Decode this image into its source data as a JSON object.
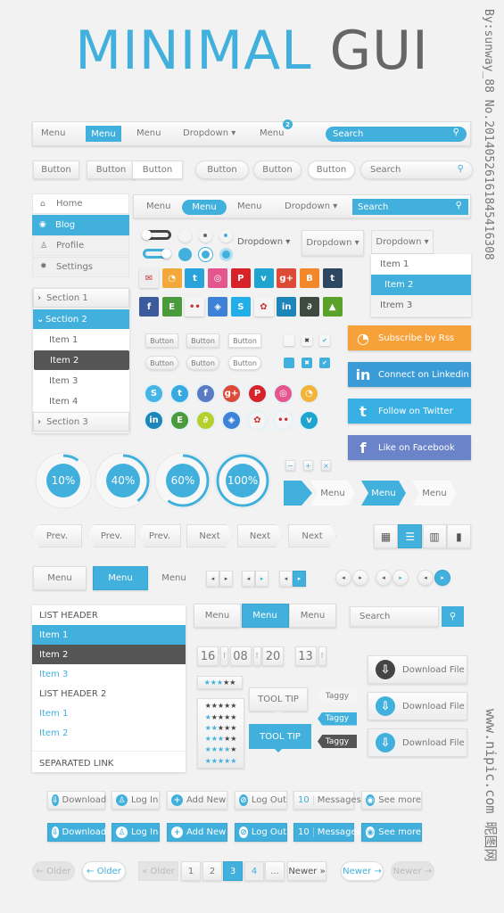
{
  "title": {
    "part1": "MINIMAL",
    "part2": "GUI"
  },
  "watermark": {
    "side": "By:sunway_88  No.20140526161845416308",
    "site": "www.nipic.com",
    "site_cn": "昵图网"
  },
  "colors": {
    "accent": "#41b0dc",
    "dark": "#555555",
    "rss": "#f7a13a",
    "linkedin": "#3a9bd6",
    "twitter": "#39b0e3",
    "facebook": "#6b83c8"
  },
  "navbar1": {
    "items": [
      "Menu",
      "Menu",
      "Menu",
      "Dropdown ▾",
      "Menu"
    ],
    "active": 1,
    "badge": "2",
    "search_placeholder": "Search"
  },
  "buttons_row": {
    "buttons": [
      "Button",
      "Button",
      "Button",
      "Button",
      "Button",
      "Button"
    ],
    "search_placeholder": "Search"
  },
  "sidebar": {
    "items": [
      {
        "label": "Home",
        "icon": "home-icon",
        "glyph": "⌂"
      },
      {
        "label": "Blog",
        "icon": "rss-icon",
        "glyph": "◉"
      },
      {
        "label": "Profile",
        "icon": "user-icon",
        "glyph": "♙"
      },
      {
        "label": "Settings",
        "icon": "gear-icon",
        "glyph": "✹"
      }
    ],
    "active": 1
  },
  "navbar2": {
    "items": [
      "Menu",
      "Menu",
      "Menu",
      "Dropdown ▾"
    ],
    "active": 1,
    "search_placeholder": "Search"
  },
  "toggles": [
    {
      "on": false
    },
    {
      "on": true
    }
  ],
  "radios": [
    "empty",
    "dot",
    "dot-blue",
    "filled",
    "filled-dark",
    "ring"
  ],
  "dropdowns": [
    "Dropdown ▾",
    "Dropdown ▾",
    "Dropdown ▾"
  ],
  "dropdown_menu": {
    "items": [
      "Item 1",
      "Item 2",
      "Itrem 3"
    ],
    "active": 1
  },
  "social_squares": [
    {
      "icon": "mail-icon",
      "glyph": "✉",
      "color": "#eeeeee"
    },
    {
      "icon": "rss-icon",
      "glyph": "◔",
      "color": "#f3a83a"
    },
    {
      "icon": "twitter-icon",
      "glyph": "t",
      "color": "#2aa3dc"
    },
    {
      "icon": "dribbble-icon",
      "glyph": "◎",
      "color": "#e5568e"
    },
    {
      "icon": "pinterest-icon",
      "glyph": "P",
      "color": "#d8222a"
    },
    {
      "icon": "vimeo-icon",
      "glyph": "v",
      "color": "#1fa4cf"
    },
    {
      "icon": "google-plus-icon",
      "glyph": "g+",
      "color": "#dc4b38"
    },
    {
      "icon": "blogger-icon",
      "glyph": "B",
      "color": "#f2882a"
    },
    {
      "icon": "tumblr-icon",
      "glyph": "t",
      "color": "#2d4761"
    },
    {
      "icon": "facebook-icon",
      "glyph": "f",
      "color": "#3c5b9a"
    },
    {
      "icon": "evernote-icon",
      "glyph": "E",
      "color": "#4a9b3c"
    },
    {
      "icon": "flickr-icon",
      "glyph": "••",
      "color": "#f4f4f4"
    },
    {
      "icon": "dropbox-icon",
      "glyph": "◈",
      "color": "#3d82d6"
    },
    {
      "icon": "skype-icon",
      "glyph": "S",
      "color": "#22aee6"
    },
    {
      "icon": "picasa-icon",
      "glyph": "✿",
      "color": "#f4f4f4"
    },
    {
      "icon": "linkedin-icon",
      "glyph": "in",
      "color": "#1d86b8"
    },
    {
      "icon": "deviantart-icon",
      "glyph": "∂",
      "color": "#3e4a40"
    },
    {
      "icon": "vine-icon",
      "glyph": "▲",
      "color": "#5ba22a"
    }
  ],
  "accordion": {
    "sections": [
      "Section 1",
      "Section 2",
      "Section 3"
    ],
    "items": [
      "Item 1",
      "Item 2",
      "Item 3",
      "Item 4"
    ],
    "open": 1,
    "active_item": 1
  },
  "small_buttons": [
    "Button",
    "Button",
    "Button",
    "Button",
    "Button",
    "Button"
  ],
  "checkboxes": [
    {
      "style": "light",
      "mark": ""
    },
    {
      "style": "light",
      "mark": "✖"
    },
    {
      "style": "light",
      "mark": "✔"
    },
    {
      "style": "blue",
      "mark": ""
    },
    {
      "style": "blue",
      "mark": "✖"
    },
    {
      "style": "blue",
      "mark": "✔"
    }
  ],
  "social_circles": [
    {
      "icon": "skype-icon",
      "glyph": "S",
      "color": "#45b4e6"
    },
    {
      "icon": "twitter-icon",
      "glyph": "t",
      "color": "#36a9e1"
    },
    {
      "icon": "facebook-icon",
      "glyph": "f",
      "color": "#5a7bc1"
    },
    {
      "icon": "google-plus-icon",
      "glyph": "g+",
      "color": "#dc4b38"
    },
    {
      "icon": "pinterest-icon",
      "glyph": "P",
      "color": "#d8222a"
    },
    {
      "icon": "dribbble-icon",
      "glyph": "◎",
      "color": "#e5568e"
    },
    {
      "icon": "rss-icon",
      "glyph": "◔",
      "color": "#f3b33a"
    },
    {
      "icon": "linkedin-icon",
      "glyph": "in",
      "color": "#1d86b8"
    },
    {
      "icon": "evernote-icon",
      "glyph": "E",
      "color": "#4a9b3c"
    },
    {
      "icon": "deviantart-icon",
      "glyph": "∂",
      "color": "#b6cf2a"
    },
    {
      "icon": "dropbox-icon",
      "glyph": "◈",
      "color": "#3d82d6"
    },
    {
      "icon": "picasa-icon",
      "glyph": "✿",
      "color": "#f4f4f4"
    },
    {
      "icon": "flickr-icon",
      "glyph": "••",
      "color": "#f4f4f4"
    },
    {
      "icon": "vimeo-icon",
      "glyph": "v",
      "color": "#1fa4cf"
    }
  ],
  "social_buttons": [
    {
      "label": "Subscribe by Rss",
      "icon": "rss-icon",
      "glyph": "◔",
      "color": "#f7a13a"
    },
    {
      "label": "Connect on Linkedin",
      "icon": "linkedin-icon",
      "glyph": "in",
      "color": "#3a9bd6"
    },
    {
      "label": "Follow on Twitter",
      "icon": "twitter-icon",
      "glyph": "t",
      "color": "#39b0e3"
    },
    {
      "label": "Like on Facebook",
      "icon": "facebook-icon",
      "glyph": "f",
      "color": "#6b83c8"
    }
  ],
  "progress": [
    {
      "value": 10,
      "label": "10%"
    },
    {
      "value": 40,
      "label": "40%"
    },
    {
      "value": 60,
      "label": "60%"
    },
    {
      "value": 100,
      "label": "100%"
    }
  ],
  "mini_buttons": [
    "−",
    "+",
    "×"
  ],
  "breadcrumb": {
    "items": [
      "Menu",
      "Menu",
      "Menu"
    ],
    "active": 1
  },
  "pager": {
    "prev": [
      "Prev.",
      "Prev.",
      "Prev."
    ],
    "next": [
      "Next",
      "Next",
      "Next"
    ]
  },
  "view_toggle": {
    "icons": [
      {
        "icon": "grid-icon",
        "glyph": "▦"
      },
      {
        "icon": "list-icon",
        "glyph": "☰"
      },
      {
        "icon": "columns-icon",
        "glyph": "▥"
      },
      {
        "icon": "barcode-icon",
        "glyph": "▮"
      }
    ],
    "active": 1
  },
  "menu_row": {
    "items": [
      "Menu",
      "Menu",
      "Menu"
    ],
    "active": 1
  },
  "arrow_groups": [
    {
      "active": "none"
    },
    {
      "active": "right-light"
    },
    {
      "active": "right"
    },
    {
      "active": "none"
    },
    {
      "active": "right-light"
    },
    {
      "active": "right"
    }
  ],
  "list_group": {
    "rows": [
      {
        "type": "header",
        "text": "LIST HEADER"
      },
      {
        "type": "active",
        "text": "Item 1"
      },
      {
        "type": "dark",
        "text": "Item 2"
      },
      {
        "type": "link",
        "text": "Item 3"
      },
      {
        "type": "header",
        "text": "LIST HEADER 2"
      },
      {
        "type": "link",
        "text": "Item 1"
      },
      {
        "type": "link",
        "text": "Item 2"
      },
      {
        "type": "sep",
        "text": "SEPARATED LINK"
      }
    ]
  },
  "tabs": {
    "items": [
      "Menu",
      "Menu",
      "Menu"
    ],
    "active": 1
  },
  "search2": {
    "placeholder": "Search",
    "button_icon": "location-pin-icon"
  },
  "time": [
    "16",
    "08",
    "20",
    "13"
  ],
  "rating": {
    "value": 3,
    "max": 5,
    "list": [
      0,
      1,
      2,
      3,
      4,
      5
    ]
  },
  "tooltips": [
    "TOOL TIP",
    "TOOL TIP"
  ],
  "tags": [
    "Taggy",
    "Taggy",
    "Taggy"
  ],
  "download_buttons": [
    "Download File",
    "Download File",
    "Download File"
  ],
  "icon_buttons": [
    {
      "label": "Download",
      "icon": "download-icon",
      "glyph": "⇩"
    },
    {
      "label": "Log In",
      "icon": "user-icon",
      "glyph": "♙"
    },
    {
      "label": "Add New",
      "icon": "plus-icon",
      "glyph": "+"
    },
    {
      "label": "Log Out",
      "icon": "slash-icon",
      "glyph": "⊘"
    },
    {
      "label": "Messages",
      "count": "10"
    },
    {
      "label": "See more",
      "icon": "eye-icon",
      "glyph": "◉"
    }
  ],
  "pagination": {
    "older": [
      "← Older",
      "← Older",
      "« Older"
    ],
    "pages": [
      "1",
      "2",
      "3",
      "4",
      "..."
    ],
    "active_index": 2,
    "newer": [
      "Newer »",
      "Newer →",
      "Newer →"
    ]
  }
}
